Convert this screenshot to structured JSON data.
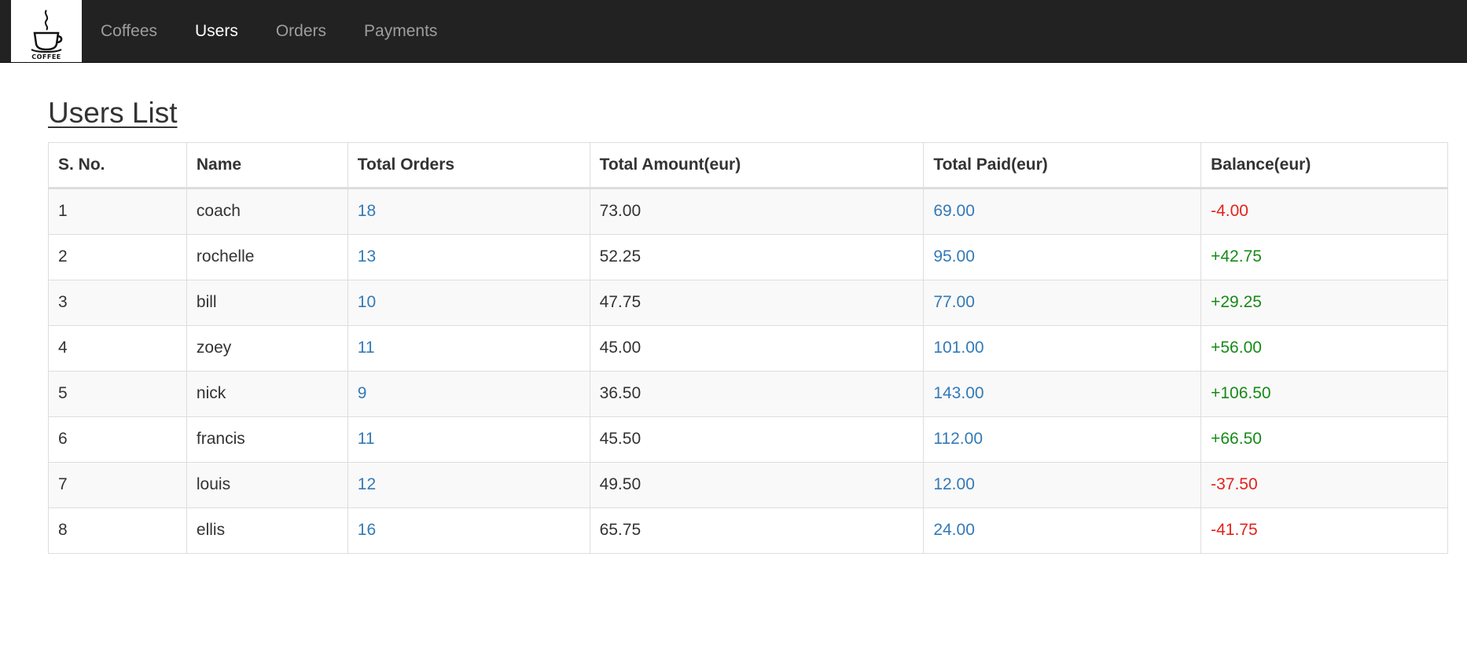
{
  "colors": {
    "navbar_bg": "#222222",
    "nav_inactive": "#9d9d9d",
    "nav_active": "#ffffff",
    "link": "#337ab7",
    "negative": "#e2231a",
    "positive": "#178a17"
  },
  "brand": {
    "logo_text": "COFFEE",
    "icon": "coffee-cup-icon"
  },
  "nav": {
    "items": [
      {
        "label": "Coffees",
        "active": false
      },
      {
        "label": "Users",
        "active": true
      },
      {
        "label": "Orders",
        "active": false
      },
      {
        "label": "Payments",
        "active": false
      }
    ]
  },
  "page": {
    "title": "Users List"
  },
  "table": {
    "headers": [
      "S. No.",
      "Name",
      "Total Orders",
      "Total Amount(eur)",
      "Total Paid(eur)",
      "Balance(eur)"
    ],
    "rows": [
      {
        "sno": "1",
        "name": "coach",
        "orders": "18",
        "amount": "73.00",
        "paid": "69.00",
        "balance": "-4.00"
      },
      {
        "sno": "2",
        "name": "rochelle",
        "orders": "13",
        "amount": "52.25",
        "paid": "95.00",
        "balance": "+42.75"
      },
      {
        "sno": "3",
        "name": "bill",
        "orders": "10",
        "amount": "47.75",
        "paid": "77.00",
        "balance": "+29.25"
      },
      {
        "sno": "4",
        "name": "zoey",
        "orders": "11",
        "amount": "45.00",
        "paid": "101.00",
        "balance": "+56.00"
      },
      {
        "sno": "5",
        "name": "nick",
        "orders": "9",
        "amount": "36.50",
        "paid": "143.00",
        "balance": "+106.50"
      },
      {
        "sno": "6",
        "name": "francis",
        "orders": "11",
        "amount": "45.50",
        "paid": "112.00",
        "balance": "+66.50"
      },
      {
        "sno": "7",
        "name": "louis",
        "orders": "12",
        "amount": "49.50",
        "paid": "12.00",
        "balance": "-37.50"
      },
      {
        "sno": "8",
        "name": "ellis",
        "orders": "16",
        "amount": "65.75",
        "paid": "24.00",
        "balance": "-41.75"
      }
    ]
  }
}
